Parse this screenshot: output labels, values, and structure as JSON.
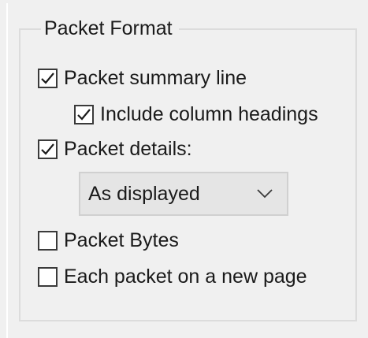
{
  "group": {
    "title": "Packet Format"
  },
  "options": {
    "summary_line": {
      "label": "Packet summary line",
      "checked": true
    },
    "column_headings": {
      "label": "Include column headings",
      "checked": true
    },
    "details": {
      "label": "Packet details:",
      "checked": true
    },
    "bytes": {
      "label": "Packet Bytes",
      "checked": false
    },
    "new_page": {
      "label": "Each packet on a new page",
      "checked": false
    }
  },
  "details_select": {
    "value": "As displayed"
  }
}
